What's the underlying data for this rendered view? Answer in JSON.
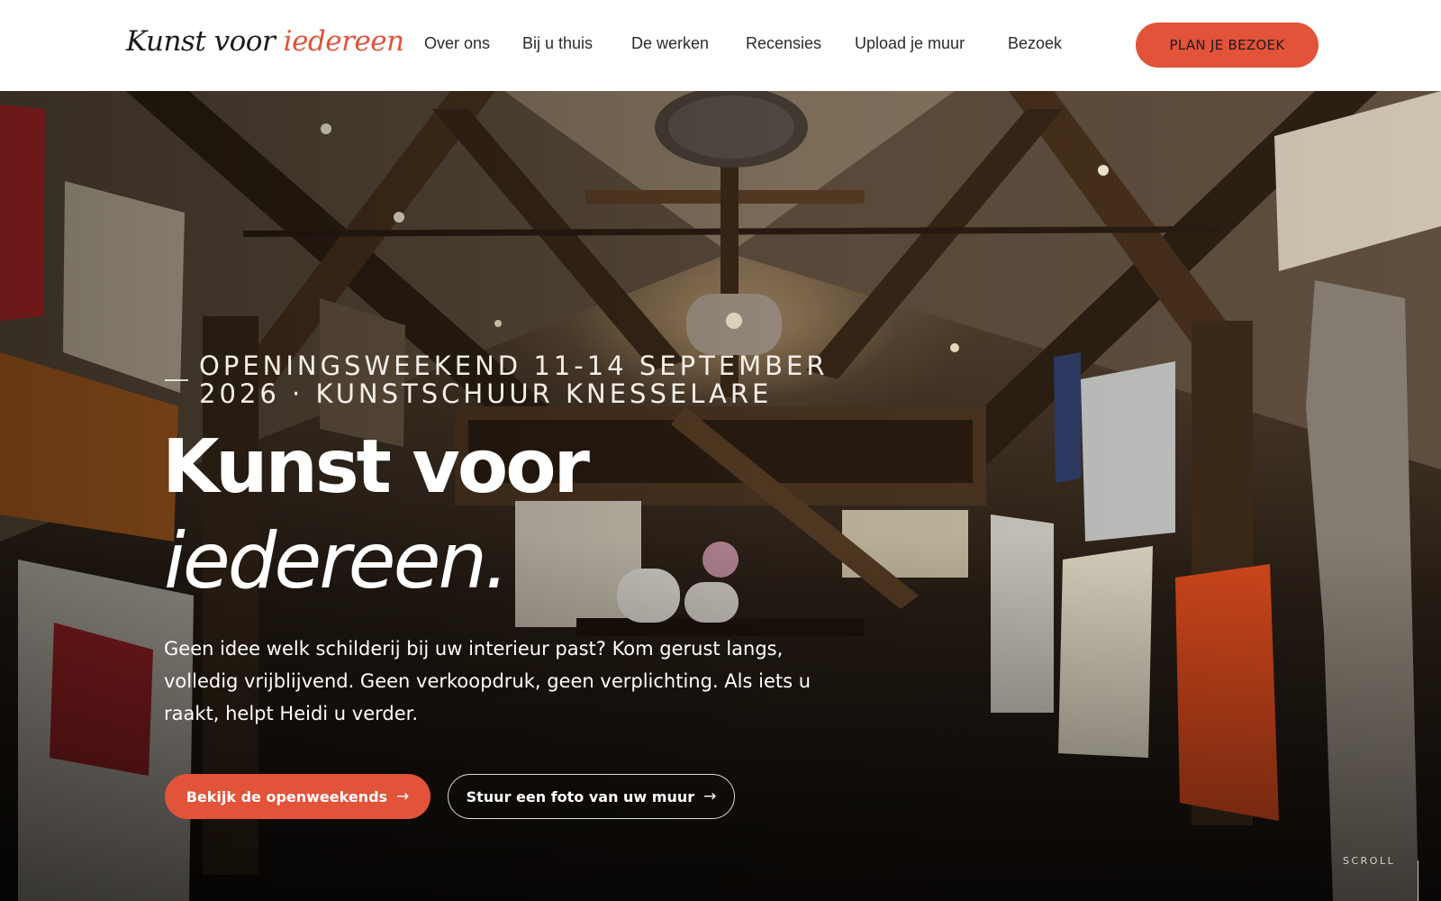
{
  "header": {
    "logo_primary": "Kunst voor",
    "logo_accent": "iedereen",
    "nav": [
      {
        "label": "Over ons"
      },
      {
        "label": "Bij u thuis"
      },
      {
        "label": "De werken"
      },
      {
        "label": "Recensies"
      },
      {
        "label": "Upload je muur"
      },
      {
        "label": "Bezoek"
      }
    ],
    "cta_label": "PLAN JE BEZOEK"
  },
  "hero": {
    "eyebrow_line1": "Openingsweekend 11-14 september",
    "eyebrow_line2": "2026 · Kunstschuur Knesselare",
    "title_line1": "Kunst voor",
    "title_line2": "iedereen",
    "title_dot": ".",
    "lead": "Geen idee welk schilderij bij uw interieur past? Kom gerust langs, volledig vrijblijvend. Geen verkoopdruk, geen verplichting. Als iets u raakt, helpt Heidi u verder.",
    "primary_button": "Bekijk de openweekends",
    "secondary_button": "Stuur een foto van uw muur",
    "arrow": "→",
    "scroll_label": "SCROLL"
  },
  "colors": {
    "accent": "#e2533a",
    "header_bg": "#ffffff",
    "nav_text": "#2b2b2b",
    "hero_text": "#ffffff"
  },
  "icons": {
    "button_arrow": "arrow-right-icon"
  }
}
